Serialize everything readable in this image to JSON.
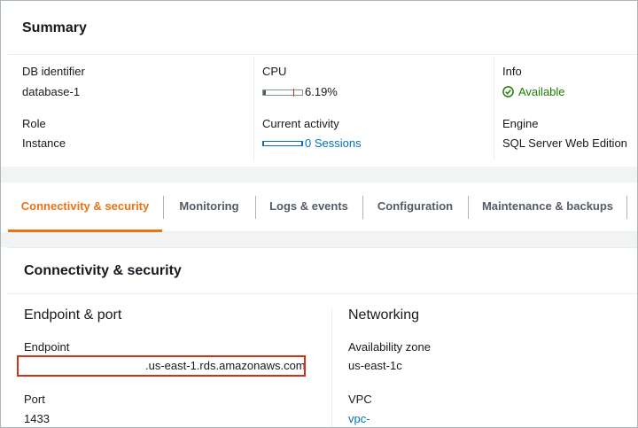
{
  "summary": {
    "title": "Summary",
    "db_identifier_label": "DB identifier",
    "db_identifier_value": "database-1",
    "role_label": "Role",
    "role_value": "Instance",
    "cpu_label": "CPU",
    "cpu_value": "6.19%",
    "cpu_fraction": 0.0619,
    "current_activity_label": "Current activity",
    "current_activity_value": "0 Sessions",
    "info_label": "Info",
    "info_value": "Available",
    "engine_label": "Engine",
    "engine_value": "SQL Server Web Edition"
  },
  "tabs": [
    {
      "label": "Connectivity & security",
      "active": true
    },
    {
      "label": "Monitoring",
      "active": false
    },
    {
      "label": "Logs & events",
      "active": false
    },
    {
      "label": "Configuration",
      "active": false
    },
    {
      "label": "Maintenance & backups",
      "active": false
    }
  ],
  "connectivity": {
    "title": "Connectivity & security",
    "endpoint_port_heading": "Endpoint & port",
    "endpoint_label": "Endpoint",
    "endpoint_value": ".us-east-1.rds.amazonaws.com",
    "port_label": "Port",
    "port_value": "1433",
    "networking_heading": "Networking",
    "az_label": "Availability zone",
    "az_value": "us-east-1c",
    "vpc_label": "VPC",
    "vpc_value": "vpc-"
  },
  "colors": {
    "accent": "#ec7211",
    "link": "#0073bb",
    "available": "#1d8102",
    "highlight": "#d13212"
  }
}
